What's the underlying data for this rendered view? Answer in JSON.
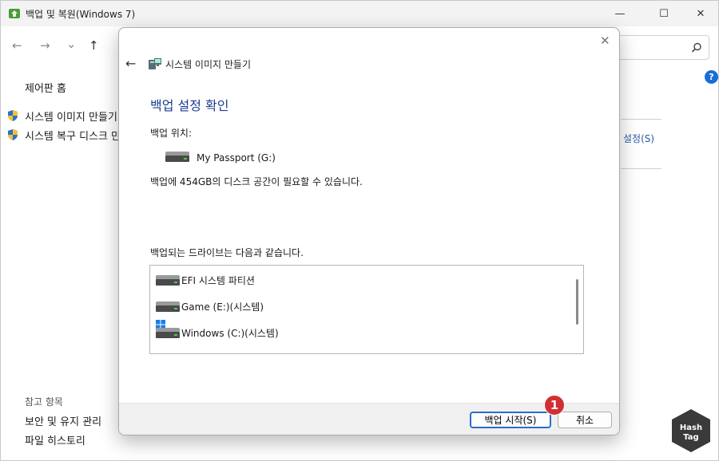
{
  "window": {
    "title": "백업 및 복원(Windows 7)",
    "min": "—",
    "max": "☐",
    "close": "✕"
  },
  "nav": {
    "back": "←",
    "forward": "→",
    "down": "⌄",
    "up": "↑"
  },
  "sidebar": {
    "title": "제어판 홈",
    "links": [
      "시스템 이미지 만들기",
      "시스템 복구 디스크 만"
    ],
    "ref_title": "참고 항목",
    "ref_links": [
      "보안 및 유지 관리",
      "파일 히스토리"
    ]
  },
  "right_panel": {
    "link": "설정(S)"
  },
  "dialog": {
    "title": "시스템 이미지 만들기",
    "heading": "백업 설정 확인",
    "location_label": "백업 위치:",
    "location_drive": "My Passport (G:)",
    "space_text": "백업에 454GB의 디스크 공간이 필요할 수 있습니다.",
    "drives_label": "백업되는 드라이브는 다음과 같습니다.",
    "drives": [
      {
        "name": "EFI 시스템 파티션",
        "icon": "drive-icon"
      },
      {
        "name": "Game (E:)(시스템)",
        "icon": "drive-icon"
      },
      {
        "name": "Windows (C:)(시스템)",
        "icon": "windows-drive-icon"
      }
    ],
    "start_button": "백업 시작(S)",
    "cancel_button": "취소"
  },
  "annotation": {
    "number": "1"
  },
  "watermark": {
    "line1": "Hash",
    "line2": "Tag"
  },
  "colors": {
    "accent": "#2a6bd6",
    "heading": "#1a3d8f",
    "callout": "#d22f33",
    "link": "#2a5aa0"
  }
}
